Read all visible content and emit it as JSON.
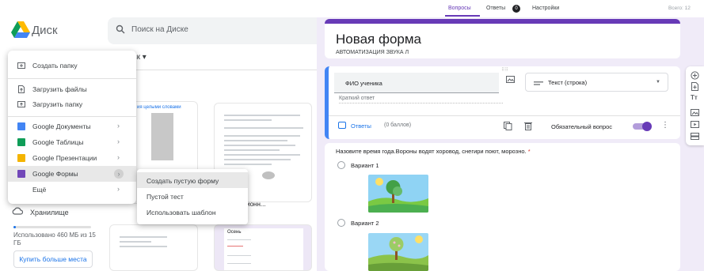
{
  "drive": {
    "app_title": "Диск",
    "search_placeholder": "Поиск на Диске",
    "breadcrumb": "иск",
    "thumb1_caption": "ия целыми словами",
    "thumb3_caption": "тикуляционн...",
    "thumb5_title": "Осень",
    "new_menu": {
      "create_folder": "Создать папку",
      "upload_files": "Загрузить файлы",
      "upload_folder": "Загрузить папку",
      "docs": "Google Документы",
      "sheets": "Google Таблицы",
      "slides": "Google Презентации",
      "forms": "Google Формы",
      "more": "Ещё"
    },
    "forms_submenu": {
      "blank_form": "Создать пустую форму",
      "blank_quiz": "Пустой тест",
      "from_template": "Использовать шаблон"
    },
    "storage_label": "Хранилище",
    "storage_used": "Использовано 460 МБ из 15 ГБ",
    "storage_fraction": 0.03,
    "buy_button": "Купить больше места"
  },
  "forms": {
    "tabs": {
      "questions": "Вопросы",
      "responses": "Ответы",
      "settings": "Настройки"
    },
    "responses_count": "0",
    "total_points": "Всего: 12",
    "title": "Новая форма",
    "description": "АВТОМАТИЗАЦИЯ ЗВУКА Л",
    "question1": {
      "title": "ФИО ученика",
      "type": "Текст (строка)",
      "answer_hint": "Краткий ответ",
      "answers_link": "Ответы",
      "points": "(0 баллов)",
      "required_label": "Обязательный вопрос"
    },
    "question2": {
      "title": "Назовите время года.Вороны водят хоровод, снегири поют, морозно.",
      "required_mark": "*",
      "options": [
        "Вариант 1",
        "Вариант 2"
      ]
    },
    "colors": {
      "accent": "#673ab7",
      "blue": "#4285f4",
      "bg": "#f0ebf8"
    }
  }
}
